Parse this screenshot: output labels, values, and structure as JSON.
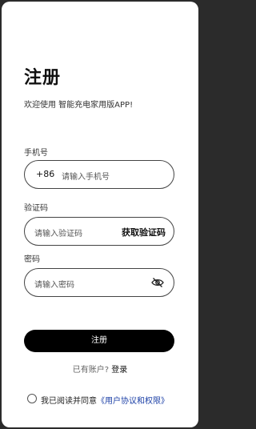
{
  "page": {
    "title": "注册",
    "subtitle": "欢迎使用 智能充电家用版APP!"
  },
  "phone": {
    "label": "手机号",
    "prefix": "+86",
    "placeholder": "请输入手机号"
  },
  "code": {
    "label": "验证码",
    "placeholder": "请输入验证码",
    "get_code": "获取验证码"
  },
  "password": {
    "label": "密码",
    "placeholder": "请输入密码",
    "toggle_icon": "eye-off-icon"
  },
  "actions": {
    "register": "注册",
    "have_account": "已有账户?",
    "login": "登录"
  },
  "agreement": {
    "prefix": "我已阅读并同意",
    "link": "《用户协议和权限》"
  },
  "colors": {
    "primary_button": "#000000",
    "link": "#1b3fa6"
  }
}
